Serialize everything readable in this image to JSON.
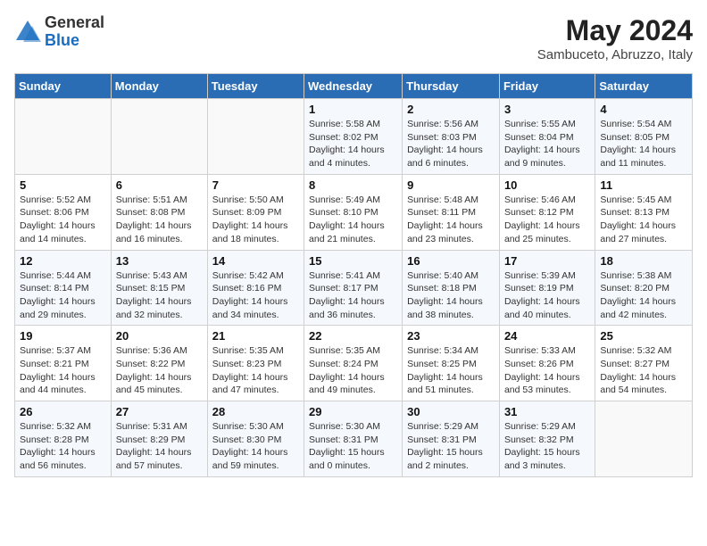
{
  "logo": {
    "general": "General",
    "blue": "Blue"
  },
  "title": {
    "month_year": "May 2024",
    "location": "Sambuceto, Abruzzo, Italy"
  },
  "header_days": [
    "Sunday",
    "Monday",
    "Tuesday",
    "Wednesday",
    "Thursday",
    "Friday",
    "Saturday"
  ],
  "weeks": [
    [
      {
        "day": "",
        "info": ""
      },
      {
        "day": "",
        "info": ""
      },
      {
        "day": "",
        "info": ""
      },
      {
        "day": "1",
        "info": "Sunrise: 5:58 AM\nSunset: 8:02 PM\nDaylight: 14 hours\nand 4 minutes."
      },
      {
        "day": "2",
        "info": "Sunrise: 5:56 AM\nSunset: 8:03 PM\nDaylight: 14 hours\nand 6 minutes."
      },
      {
        "day": "3",
        "info": "Sunrise: 5:55 AM\nSunset: 8:04 PM\nDaylight: 14 hours\nand 9 minutes."
      },
      {
        "day": "4",
        "info": "Sunrise: 5:54 AM\nSunset: 8:05 PM\nDaylight: 14 hours\nand 11 minutes."
      }
    ],
    [
      {
        "day": "5",
        "info": "Sunrise: 5:52 AM\nSunset: 8:06 PM\nDaylight: 14 hours\nand 14 minutes."
      },
      {
        "day": "6",
        "info": "Sunrise: 5:51 AM\nSunset: 8:08 PM\nDaylight: 14 hours\nand 16 minutes."
      },
      {
        "day": "7",
        "info": "Sunrise: 5:50 AM\nSunset: 8:09 PM\nDaylight: 14 hours\nand 18 minutes."
      },
      {
        "day": "8",
        "info": "Sunrise: 5:49 AM\nSunset: 8:10 PM\nDaylight: 14 hours\nand 21 minutes."
      },
      {
        "day": "9",
        "info": "Sunrise: 5:48 AM\nSunset: 8:11 PM\nDaylight: 14 hours\nand 23 minutes."
      },
      {
        "day": "10",
        "info": "Sunrise: 5:46 AM\nSunset: 8:12 PM\nDaylight: 14 hours\nand 25 minutes."
      },
      {
        "day": "11",
        "info": "Sunrise: 5:45 AM\nSunset: 8:13 PM\nDaylight: 14 hours\nand 27 minutes."
      }
    ],
    [
      {
        "day": "12",
        "info": "Sunrise: 5:44 AM\nSunset: 8:14 PM\nDaylight: 14 hours\nand 29 minutes."
      },
      {
        "day": "13",
        "info": "Sunrise: 5:43 AM\nSunset: 8:15 PM\nDaylight: 14 hours\nand 32 minutes."
      },
      {
        "day": "14",
        "info": "Sunrise: 5:42 AM\nSunset: 8:16 PM\nDaylight: 14 hours\nand 34 minutes."
      },
      {
        "day": "15",
        "info": "Sunrise: 5:41 AM\nSunset: 8:17 PM\nDaylight: 14 hours\nand 36 minutes."
      },
      {
        "day": "16",
        "info": "Sunrise: 5:40 AM\nSunset: 8:18 PM\nDaylight: 14 hours\nand 38 minutes."
      },
      {
        "day": "17",
        "info": "Sunrise: 5:39 AM\nSunset: 8:19 PM\nDaylight: 14 hours\nand 40 minutes."
      },
      {
        "day": "18",
        "info": "Sunrise: 5:38 AM\nSunset: 8:20 PM\nDaylight: 14 hours\nand 42 minutes."
      }
    ],
    [
      {
        "day": "19",
        "info": "Sunrise: 5:37 AM\nSunset: 8:21 PM\nDaylight: 14 hours\nand 44 minutes."
      },
      {
        "day": "20",
        "info": "Sunrise: 5:36 AM\nSunset: 8:22 PM\nDaylight: 14 hours\nand 45 minutes."
      },
      {
        "day": "21",
        "info": "Sunrise: 5:35 AM\nSunset: 8:23 PM\nDaylight: 14 hours\nand 47 minutes."
      },
      {
        "day": "22",
        "info": "Sunrise: 5:35 AM\nSunset: 8:24 PM\nDaylight: 14 hours\nand 49 minutes."
      },
      {
        "day": "23",
        "info": "Sunrise: 5:34 AM\nSunset: 8:25 PM\nDaylight: 14 hours\nand 51 minutes."
      },
      {
        "day": "24",
        "info": "Sunrise: 5:33 AM\nSunset: 8:26 PM\nDaylight: 14 hours\nand 53 minutes."
      },
      {
        "day": "25",
        "info": "Sunrise: 5:32 AM\nSunset: 8:27 PM\nDaylight: 14 hours\nand 54 minutes."
      }
    ],
    [
      {
        "day": "26",
        "info": "Sunrise: 5:32 AM\nSunset: 8:28 PM\nDaylight: 14 hours\nand 56 minutes."
      },
      {
        "day": "27",
        "info": "Sunrise: 5:31 AM\nSunset: 8:29 PM\nDaylight: 14 hours\nand 57 minutes."
      },
      {
        "day": "28",
        "info": "Sunrise: 5:30 AM\nSunset: 8:30 PM\nDaylight: 14 hours\nand 59 minutes."
      },
      {
        "day": "29",
        "info": "Sunrise: 5:30 AM\nSunset: 8:31 PM\nDaylight: 15 hours\nand 0 minutes."
      },
      {
        "day": "30",
        "info": "Sunrise: 5:29 AM\nSunset: 8:31 PM\nDaylight: 15 hours\nand 2 minutes."
      },
      {
        "day": "31",
        "info": "Sunrise: 5:29 AM\nSunset: 8:32 PM\nDaylight: 15 hours\nand 3 minutes."
      },
      {
        "day": "",
        "info": ""
      }
    ]
  ]
}
